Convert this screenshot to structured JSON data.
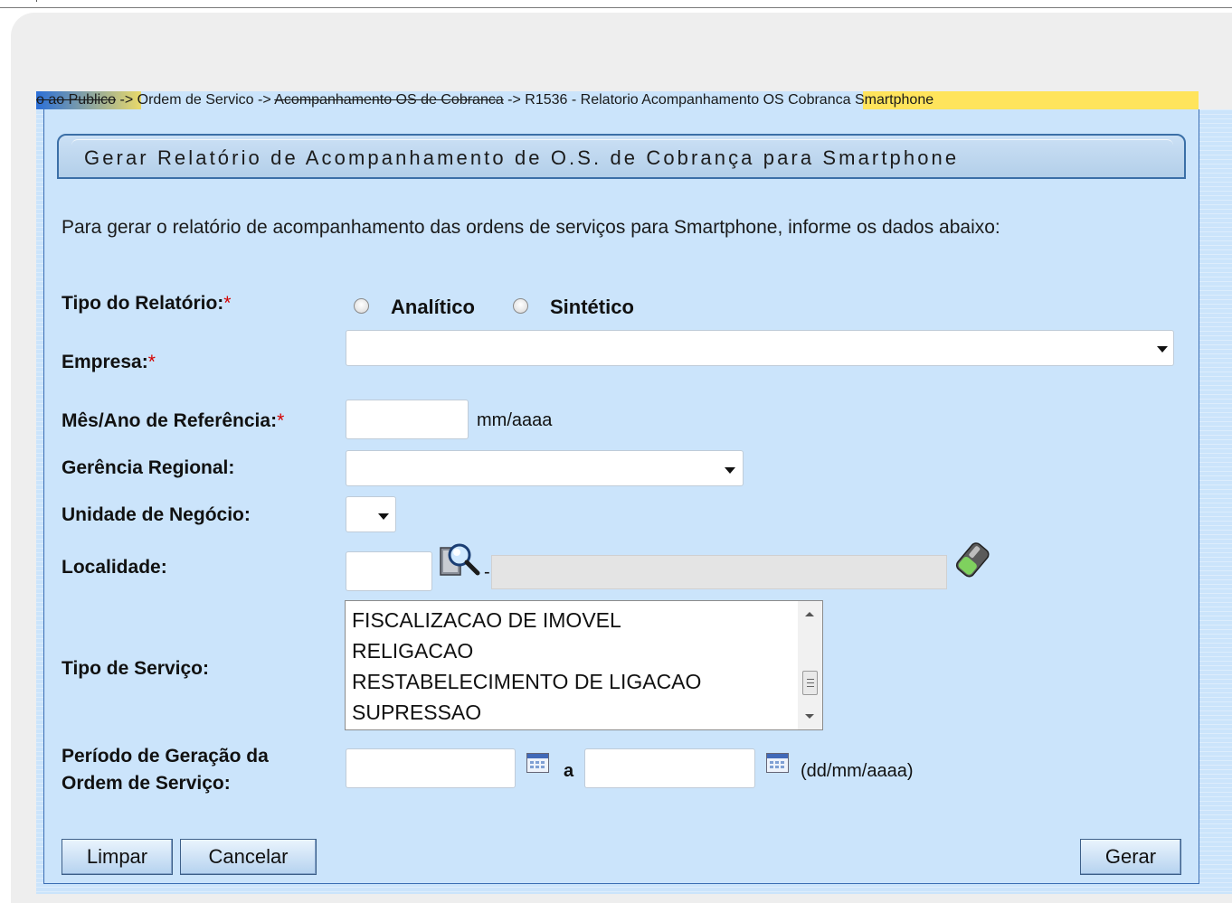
{
  "breadcrumb": {
    "part1": "o ao Publico",
    "sep": " -> ",
    "part2": "Ordem de Servico",
    "part3": "Acompanhamento OS de Cobranca",
    "part4": "R1536 - Relatorio Acompanhamento OS Cobranca Smartphone"
  },
  "page": {
    "title": "Gerar Relatório de Acompanhamento de O.S. de Cobrança para Smartphone",
    "instruction": "Para gerar o relatório de acompanhamento das ordens de serviços para Smartphone, informe os dados abaixo:"
  },
  "labels": {
    "tipo_relatorio": "Tipo do Relatório:",
    "empresa": "Empresa:",
    "mes_ano": "Mês/Ano de Referência:",
    "gerencia": "Gerência Regional:",
    "unidade": "Unidade de Negócio:",
    "localidade": "Localidade:",
    "tipo_servico": "Tipo de Serviço:",
    "periodo_line1": "Período de Geração da",
    "periodo_line2": "Ordem de Serviço:",
    "required_mark": "*"
  },
  "radios": {
    "analitico": "Analítico",
    "sintetico": "Sintético"
  },
  "fields": {
    "empresa_value": "",
    "mes_ano_value": "",
    "mes_ano_hint": "mm/aaaa",
    "gerencia_value": "",
    "unidade_value": "",
    "localidade_code": "",
    "localidade_sep": "-",
    "localidade_name": "",
    "periodo_from": "",
    "periodo_to": "",
    "periodo_sep": "a",
    "periodo_hint": "(dd/mm/aaaa)"
  },
  "tipo_servico_options": [
    "FISCALIZACAO DE IMOVEL",
    "RELIGACAO",
    "RESTABELECIMENTO DE LIGACAO",
    "SUPRESSAO"
  ],
  "buttons": {
    "limpar": "Limpar",
    "cancelar": "Cancelar",
    "gerar": "Gerar"
  },
  "icons": {
    "search": "magnifier-search-icon",
    "clear": "eraser-icon",
    "calendar": "calendar-icon"
  },
  "colors": {
    "form_bg": "#cbe4fb",
    "panel_bg": "#eeeeee",
    "border": "#3b6fa7",
    "required": "#d40000",
    "highlight": "#ffe45c"
  }
}
